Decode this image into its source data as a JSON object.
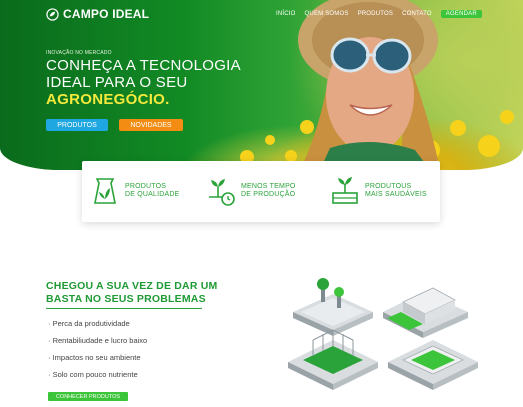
{
  "brand": {
    "name": "CAMPO IDEAL"
  },
  "nav": {
    "items": [
      "INÍCIO",
      "QUEM SOMOS",
      "PRODUTOS",
      "CONTATO"
    ],
    "cta_label": "AGENDAR"
  },
  "hero": {
    "kicker": "INOVAÇÃO NO MERCADO",
    "headline_line1": "CONHEÇA A TECNOLOGIA",
    "headline_line2": "IDEAL PARA O SEU",
    "headline_accent": "AGRONEGÓCIO.",
    "btn_products": "PRODUTOS",
    "btn_news": "NOVIDADES"
  },
  "features": [
    {
      "icon": "seed-bag-icon",
      "line1": "PRODUTOS",
      "line2": "DE QUALIDADE"
    },
    {
      "icon": "sprout-clock-icon",
      "line1": "MENOS TEMPO",
      "line2": "DE PRODUÇÃO"
    },
    {
      "icon": "seedling-crate-icon",
      "line1": "PRODUTOUS",
      "line2": "MAIS SAUDÁVEIS"
    }
  ],
  "problems": {
    "title_line1": "CHEGOU A SUA VEZ DE DAR UM",
    "title_line2": "BASTA NO SEUS PROBLEMAS",
    "items": [
      "· Perca da produtividade",
      "· Rentabiliudade e lucro baixo",
      "· Impactos no seu ambiente",
      "· Solo com pouco nutriente"
    ],
    "cta_label": "CONHECER PRODUTOS"
  },
  "colors": {
    "green": "#2aa33a",
    "accent_yellow": "#f4e93c",
    "blue": "#1ea7e0",
    "orange": "#f28c13"
  }
}
